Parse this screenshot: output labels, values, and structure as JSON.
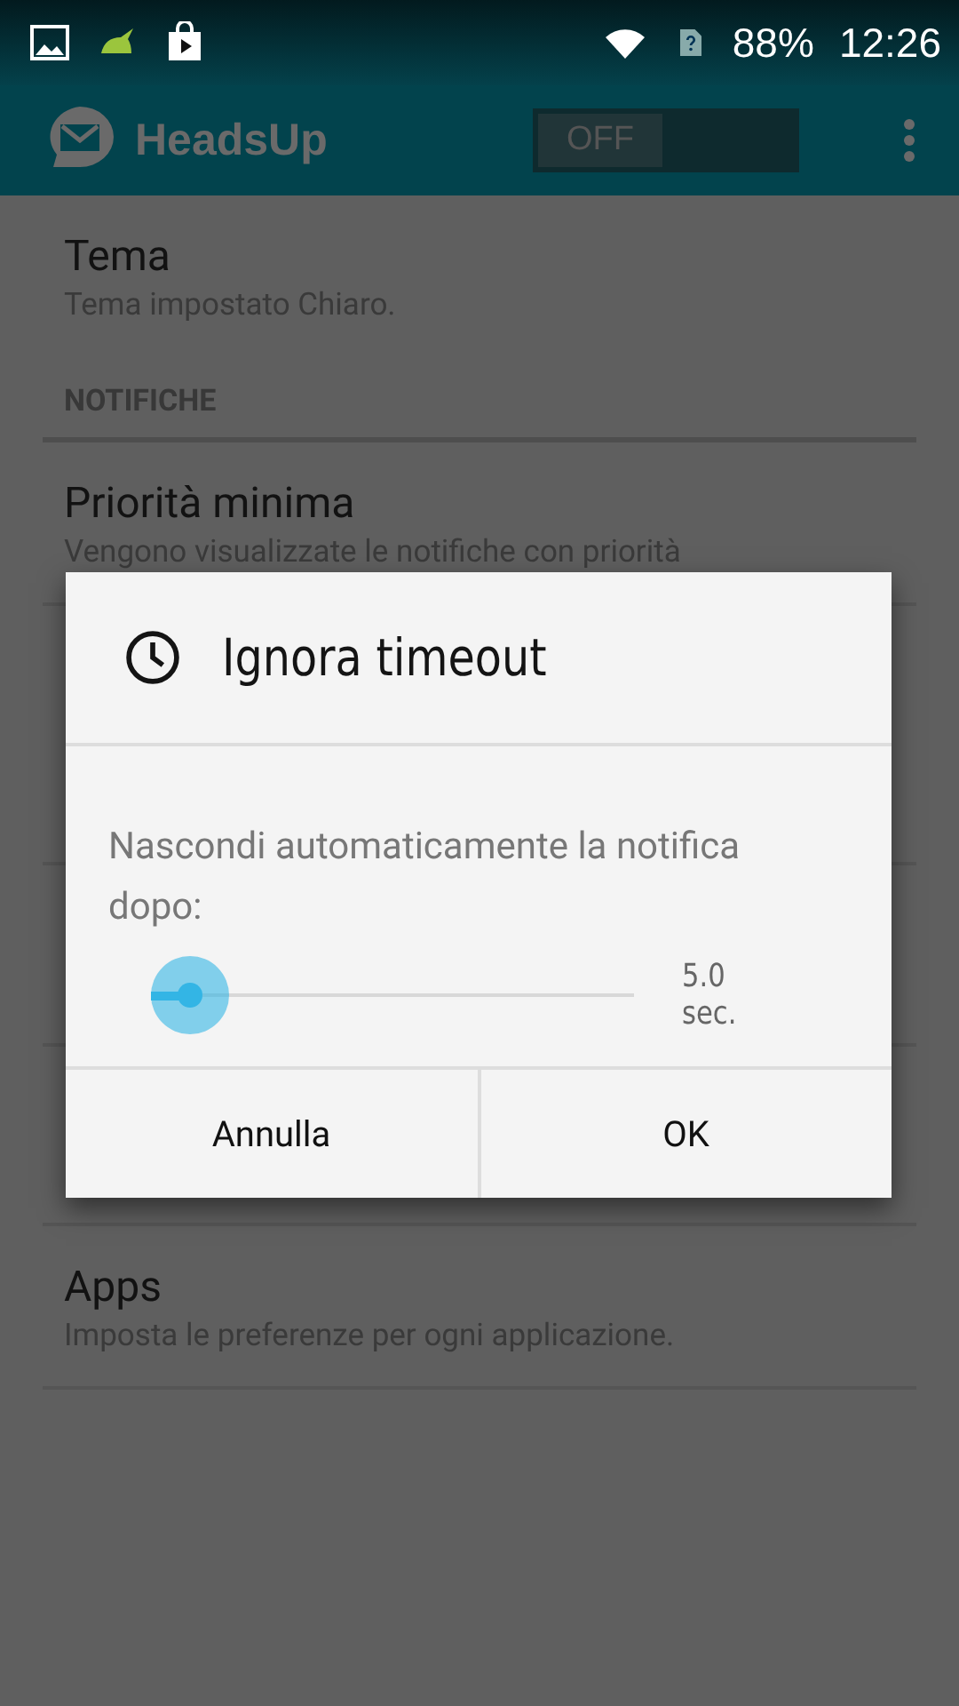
{
  "status_bar": {
    "battery": "88%",
    "time": "12:26"
  },
  "action_bar": {
    "title": "HeadsUp",
    "toggle": {
      "label": "OFF",
      "on": false
    }
  },
  "settings": [
    {
      "kind": "item",
      "title": "Tema",
      "summary": "Tema impostato Chiaro."
    },
    {
      "kind": "header",
      "title": "NOTIFICHE"
    },
    {
      "kind": "item",
      "title": "Priorità minima",
      "summary": "Vengono visualizzate le notifiche con priorità"
    },
    {
      "kind": "hidden"
    },
    {
      "kind": "hidden"
    },
    {
      "kind": "hidden"
    },
    {
      "kind": "item",
      "title": "Apps",
      "summary": "Imposta le preferenze per ogni applicazione."
    }
  ],
  "dialog": {
    "title": "Ignora timeout",
    "message": "Nascondi automaticamente la notifica dopo:",
    "slider": {
      "level": 0.08
    },
    "reading": "5.0 sec.",
    "buttons": [
      "Annulla",
      "OK"
    ]
  }
}
